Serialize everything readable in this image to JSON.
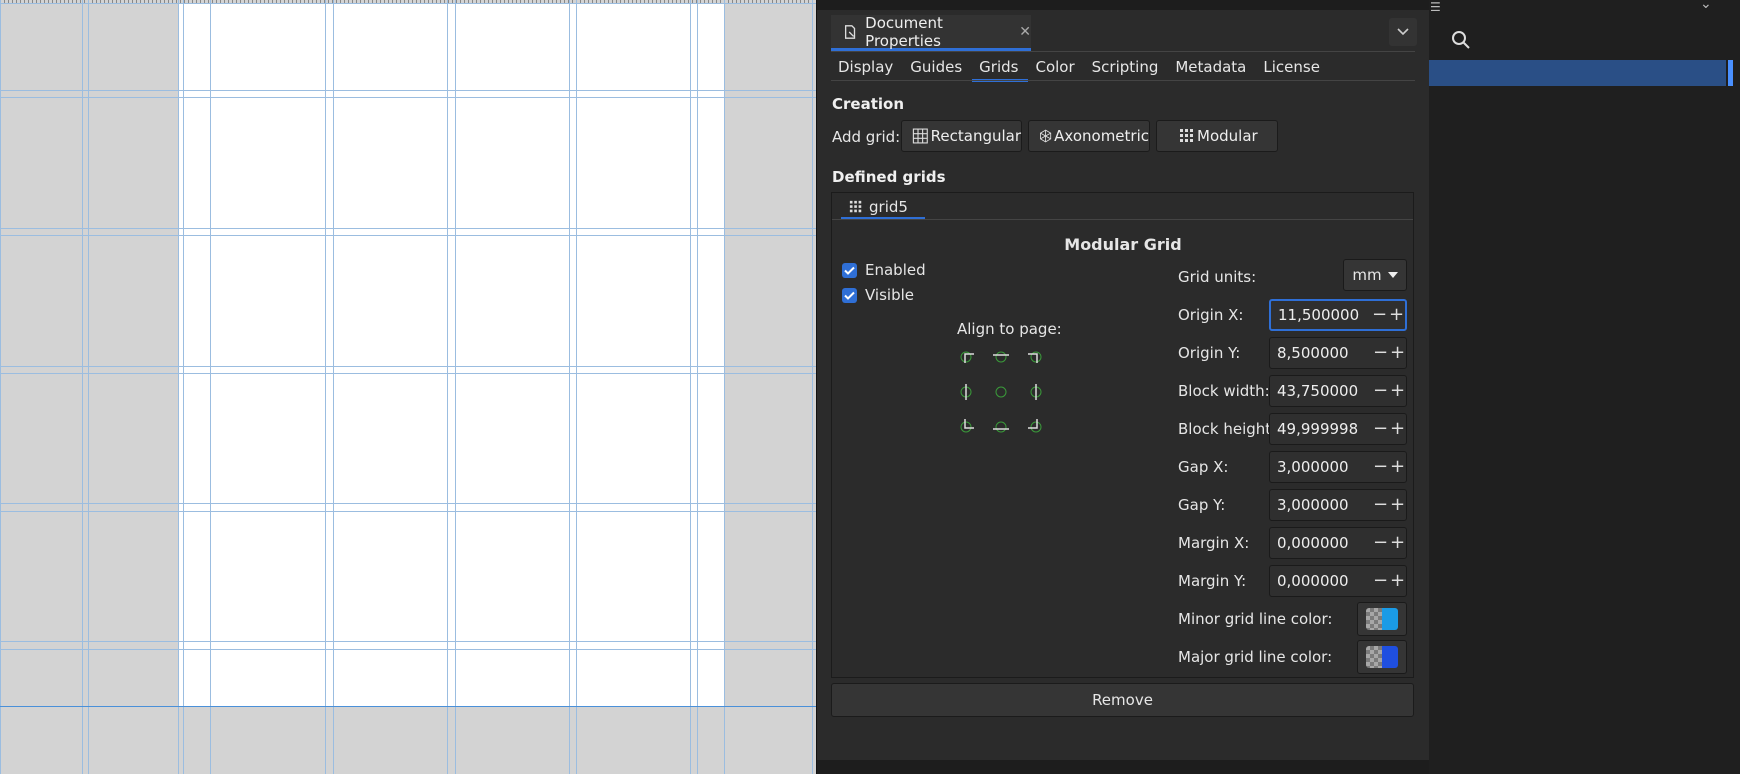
{
  "dialog": {
    "tab_title": "Document Properties",
    "tabs": [
      "Display",
      "Guides",
      "Grids",
      "Color",
      "Scripting",
      "Metadata",
      "License"
    ],
    "active_tab": "Grids"
  },
  "creation": {
    "title": "Creation",
    "add_grid_label": "Add grid:",
    "buttons": {
      "rectangular": "Rectangular",
      "axonometric": "Axonometric",
      "modular": "Modular"
    }
  },
  "defined": {
    "title": "Defined grids",
    "grid_tab": "grid5",
    "grid_title": "Modular Grid",
    "enabled_label": "Enabled",
    "enabled": true,
    "visible_label": "Visible",
    "visible": true,
    "align_label": "Align to page:",
    "grid_units_label": "Grid units:",
    "grid_units": "mm",
    "fields": {
      "origin_x": {
        "label": "Origin X:",
        "value": "11,500000"
      },
      "origin_y": {
        "label": "Origin Y:",
        "value": "8,500000"
      },
      "block_width": {
        "label": "Block width:",
        "value": "43,750000"
      },
      "block_height": {
        "label": "Block height:",
        "value": "49,999998"
      },
      "gap_x": {
        "label": "Gap X:",
        "value": "3,000000"
      },
      "gap_y": {
        "label": "Gap Y:",
        "value": "3,000000"
      },
      "margin_x": {
        "label": "Margin X:",
        "value": "0,000000"
      },
      "margin_y": {
        "label": "Margin Y:",
        "value": "0,000000"
      }
    },
    "minor_color_label": "Minor grid line color:",
    "minor_color": "#1a9be6",
    "major_color_label": "Major grid line color:",
    "major_color": "#1f4fe0",
    "remove_label": "Remove"
  },
  "colors": {
    "accent": "#2f6fd6",
    "grid_line": "#9bbde0",
    "page_border": "#4a90d9"
  }
}
